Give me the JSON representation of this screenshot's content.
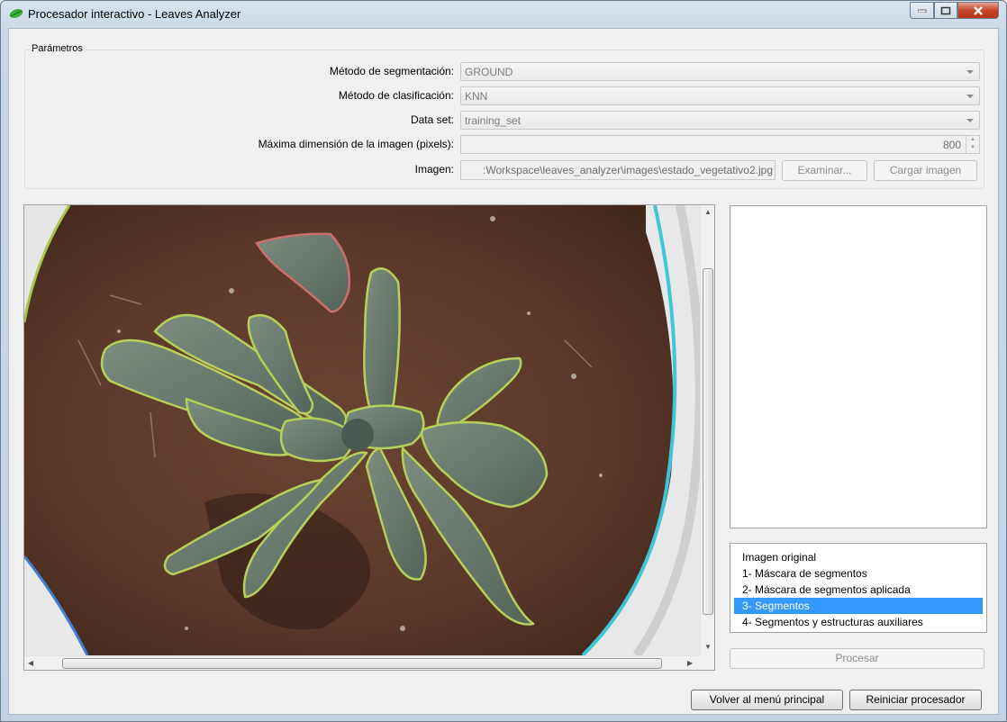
{
  "window": {
    "title": "Procesador interactivo - Leaves Analyzer"
  },
  "params": {
    "group_title": "Parámetros",
    "seg_label": "Método de segmentación:",
    "seg_value": "GROUND",
    "class_label": "Método de clasificación:",
    "class_value": "KNN",
    "dataset_label": "Data set:",
    "dataset_value": "training_set",
    "maxdim_label": "Máxima dimensión de la imagen (pixels):",
    "maxdim_value": "800",
    "image_label": "Imagen:",
    "image_path": ":Workspace\\leaves_analyzer\\images\\estado_vegetativo2.jpg",
    "browse_label": "Examinar...",
    "load_label": "Cargar imagen"
  },
  "views": {
    "items": [
      {
        "label": "Imagen original",
        "selected": false
      },
      {
        "label": "1- Máscara de segmentos",
        "selected": false
      },
      {
        "label": "2- Máscara de segmentos aplicada",
        "selected": false
      },
      {
        "label": "3- Segmentos",
        "selected": true
      },
      {
        "label": "4- Segmentos y estructuras auxiliares",
        "selected": false
      }
    ]
  },
  "actions": {
    "process_label": "Procesar",
    "back_label": "Volver al menú principal",
    "reset_label": "Reiniciar procesador"
  }
}
